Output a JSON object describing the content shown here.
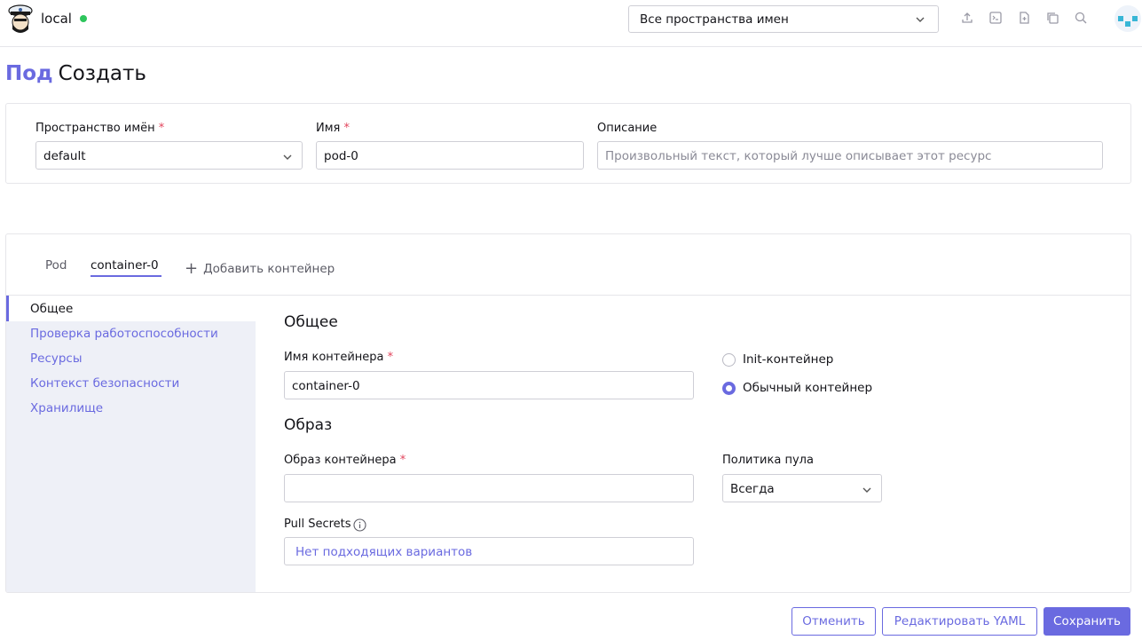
{
  "header": {
    "cluster_name": "local",
    "namespace_select": "Все пространства имен",
    "icons": [
      "upload-icon",
      "terminal-icon",
      "file-add-icon",
      "copy-icon",
      "search-icon"
    ],
    "status_color": "#2ec55c"
  },
  "title": {
    "kind": "Под",
    "action": "Создать"
  },
  "meta": {
    "namespace_label": "Пространство имён",
    "namespace_value": "default",
    "name_label": "Имя",
    "name_value": "pod-0",
    "description_label": "Описание",
    "description_placeholder": "Произвольный текст, который лучше описывает этот ресурс"
  },
  "tabs": {
    "pod": "Pod",
    "container": "container-0",
    "add": "Добавить контейнер"
  },
  "sidenav": [
    "Общее",
    "Проверка работоспособности",
    "Ресурсы",
    "Контекст безопасности",
    "Хранилище"
  ],
  "general": {
    "title": "Общее",
    "container_name_label": "Имя контейнера",
    "container_name_value": "container-0",
    "radio_init": "Init-контейнер",
    "radio_standard": "Обычный контейнер",
    "radio_selected": "standard"
  },
  "image": {
    "title": "Образ",
    "image_label": "Образ контейнера",
    "image_value": "",
    "pull_policy_label": "Политика пула",
    "pull_policy_value": "Всегда",
    "pull_secrets_label": "Pull Secrets",
    "pull_secrets_placeholder": "Нет подходящих вариантов"
  },
  "actions": {
    "cancel": "Отменить",
    "edit_yaml": "Редактировать YAML",
    "save": "Сохранить"
  },
  "colors": {
    "accent": "#6a6ae0",
    "required": "#e2445c"
  }
}
